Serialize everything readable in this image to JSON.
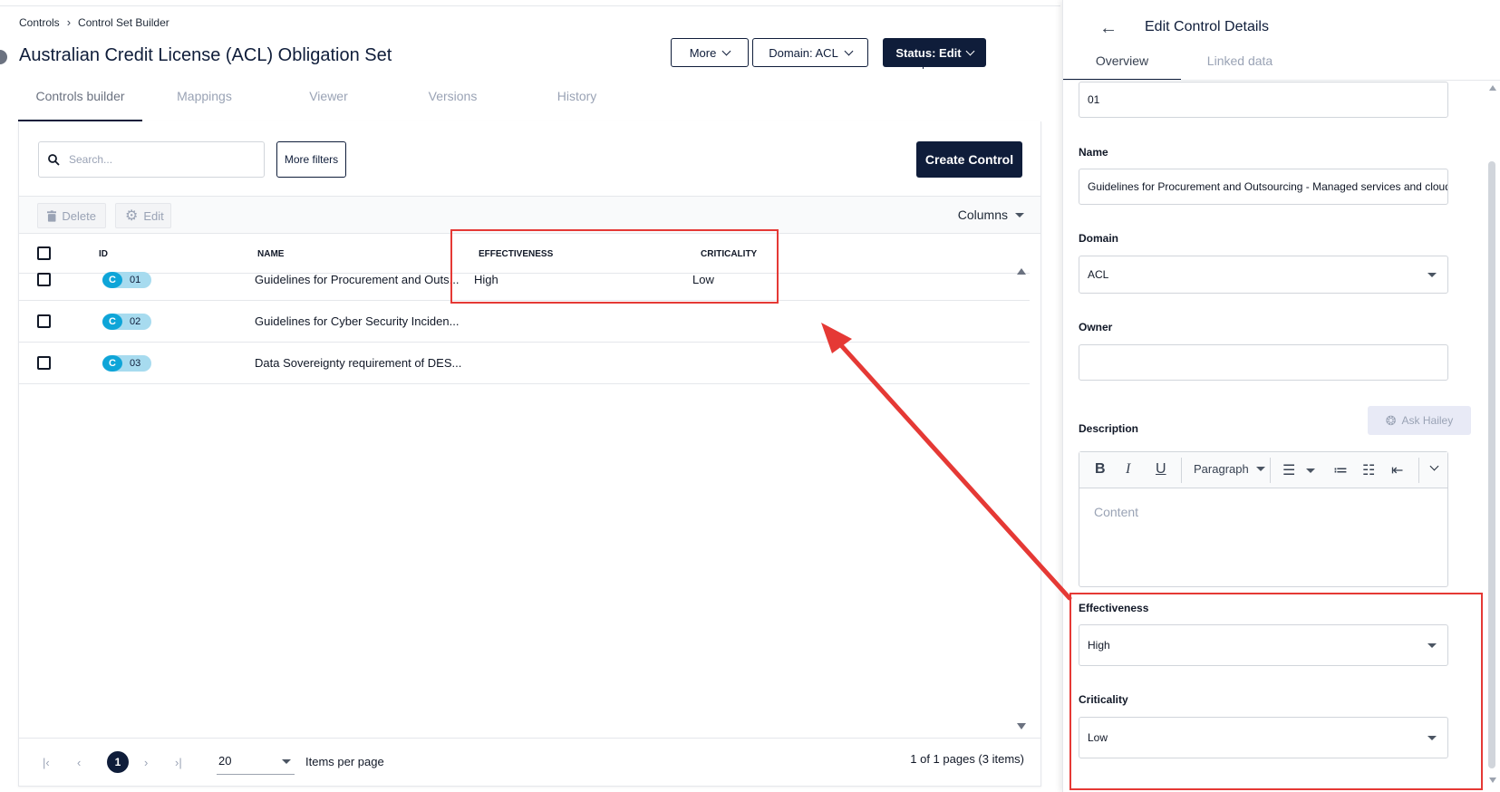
{
  "breadcrumb": {
    "root": "Controls",
    "current": "Control Set Builder"
  },
  "page": {
    "title": "Australian Credit License (ACL) Obligation Set"
  },
  "header_actions": {
    "more": "More",
    "domain": "Domain: ACL",
    "status": "Status: Edit"
  },
  "tabs": [
    {
      "label": "Controls builder",
      "active": true
    },
    {
      "label": "Mappings"
    },
    {
      "label": "Viewer"
    },
    {
      "label": "Versions"
    },
    {
      "label": "History"
    }
  ],
  "search": {
    "placeholder": "Search..."
  },
  "filters": {
    "more_label": "More filters"
  },
  "create_label": "Create Control",
  "toolbar": {
    "delete_label": "Delete",
    "edit_label": "Edit",
    "columns_label": "Columns"
  },
  "table": {
    "columns": [
      "ID",
      "NAME",
      "EFFECTIVENESS",
      "CRITICALITY"
    ],
    "rows": [
      {
        "type": "C",
        "id": "01",
        "name": "Guidelines for Procurement and Outs...",
        "effectiveness": "High",
        "criticality": "Low"
      },
      {
        "type": "C",
        "id": "02",
        "name": "Guidelines for Cyber Security Inciden...",
        "effectiveness": "",
        "criticality": ""
      },
      {
        "type": "C",
        "id": "03",
        "name": "Data Sovereignty requirement of DES...",
        "effectiveness": "",
        "criticality": ""
      }
    ]
  },
  "pager": {
    "current_page": "1",
    "page_size": "20",
    "per_page_label": "Items per page",
    "info": "1 of 1 pages (3 items)"
  },
  "drawer": {
    "title": "Edit Control Details",
    "tabs": [
      "Overview",
      "Linked data"
    ],
    "id_value": "01",
    "name_label": "Name",
    "name_value": "Guidelines for Procurement and Outsourcing - Managed services and cloud serv",
    "domain_label": "Domain",
    "domain_value": "ACL",
    "owner_label": "Owner",
    "owner_value": "",
    "description_label": "Description",
    "ask_label": "Ask Hailey",
    "editor_paragraph": "Paragraph",
    "editor_placeholder": "Content",
    "effectiveness_label": "Effectiveness",
    "effectiveness_value": "High",
    "criticality_label": "Criticality",
    "criticality_value": "Low"
  },
  "colors": {
    "brand": "#0f1d3a",
    "annotation": "#e53935",
    "badge": "#0ea5d8"
  }
}
